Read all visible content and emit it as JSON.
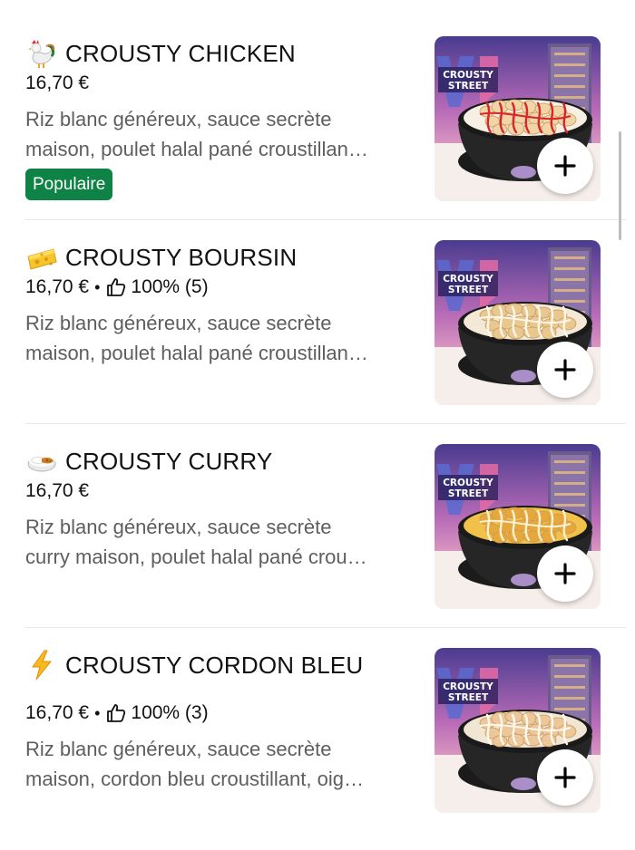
{
  "menu": {
    "items": [
      {
        "emoji": "rooster-emoji",
        "title": "CROUSTY CHICKEN",
        "price": "16,70 €",
        "rating": "",
        "desc_line1": "Riz blanc généreux, sauce secrète",
        "desc_line2": "maison, poulet halal pané croustillan…",
        "badge": "Populaire",
        "sauce": "red",
        "add_icon": "plus-icon"
      },
      {
        "emoji": "cheese-emoji",
        "title": "CROUSTY BOURSIN",
        "price": "16,70 €",
        "rating": "100% (5)",
        "desc_line1": "Riz blanc généreux, sauce secrète",
        "desc_line2": "maison, poulet halal pané croustillan…",
        "badge": "",
        "sauce": "cream",
        "add_icon": "plus-icon"
      },
      {
        "emoji": "curry-rice-emoji",
        "title": "CROUSTY CURRY",
        "price": "16,70 €",
        "rating": "",
        "desc_line1": "Riz blanc généreux, sauce secrète",
        "desc_line2": "curry maison, poulet halal pané crou…",
        "badge": "",
        "sauce": "curry",
        "add_icon": "plus-icon"
      },
      {
        "emoji": "lightning-emoji",
        "title": "CROUSTY CORDON BLEU",
        "price": "16,70 €",
        "rating": "100% (3)",
        "desc_line1": "Riz blanc généreux, sauce secrète",
        "desc_line2": "maison, cordon bleu croustillant, oig…",
        "badge": "",
        "sauce": "cordon",
        "add_icon": "plus-icon"
      }
    ],
    "image_logo_line1": "CROUSTY",
    "image_logo_line2": "STREET"
  },
  "colors": {
    "badge_green": "#0e8345",
    "desc_gray": "#5e5e5e"
  }
}
